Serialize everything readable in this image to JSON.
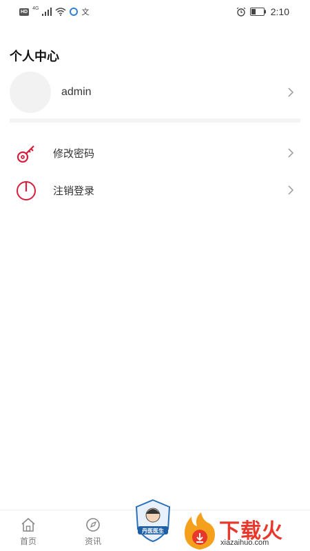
{
  "status_bar": {
    "hd_badge": "HD",
    "network": "4G",
    "app_glyph": "文",
    "time": "2:10"
  },
  "page": {
    "title": "个人中心"
  },
  "profile": {
    "username": "admin"
  },
  "menu": {
    "items": [
      {
        "label": "修改密码",
        "icon": "key-icon"
      },
      {
        "label": "注销登录",
        "icon": "power-icon"
      }
    ]
  },
  "bottom_nav": {
    "tabs": [
      {
        "label": "首页",
        "icon": "home-icon"
      },
      {
        "label": "资讯",
        "icon": "news-icon"
      }
    ],
    "center_badge_text": "丹医医生"
  },
  "watermark": {
    "title": "下载火",
    "url": "xiazaihuo.com"
  },
  "colors": {
    "accent": "#d81e3c",
    "watermark": "#e8382b"
  }
}
